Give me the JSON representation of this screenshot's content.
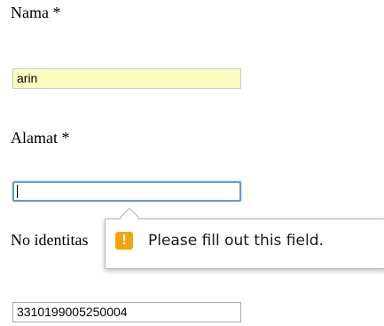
{
  "form": {
    "nama": {
      "label": "Nama *",
      "value": "arin"
    },
    "alamat": {
      "label": "Alamat *",
      "value": ""
    },
    "no_identitas": {
      "label": "No identitas",
      "value": "3310199005250004"
    }
  },
  "validation_tooltip": {
    "icon": "warning-icon",
    "icon_glyph": "!",
    "message": "Please fill out this field.",
    "icon_color": "#f4a411"
  },
  "colors": {
    "autofill_background": "#fafdbf",
    "focus_border": "#6d99ce"
  }
}
